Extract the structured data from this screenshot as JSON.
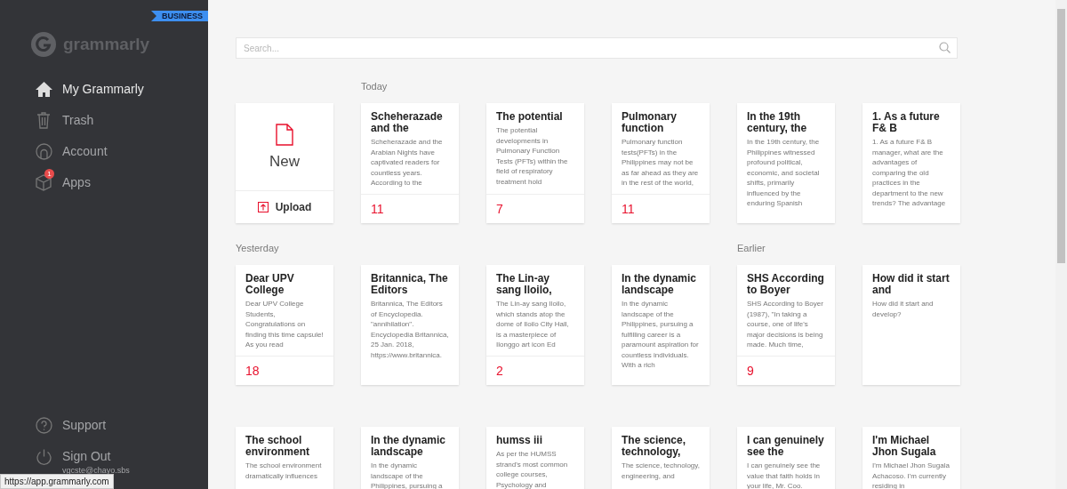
{
  "sidebar": {
    "plan": "BUSINESS",
    "logo": "grammarly",
    "nav": [
      {
        "label": "My Grammarly",
        "selected": true
      },
      {
        "label": "Trash",
        "selected": false
      },
      {
        "label": "Account",
        "selected": false
      },
      {
        "label": "Apps",
        "selected": false,
        "badge": "1"
      }
    ],
    "footer": [
      {
        "label": "Support"
      },
      {
        "label": "Sign Out"
      }
    ],
    "email": "vgcste@chayo.sbs"
  },
  "search": {
    "placeholder": "Search..."
  },
  "rows": [
    {
      "cards": [
        {
          "kind": "new",
          "label": "New",
          "action": "Upload"
        },
        {
          "kind": "doc",
          "section": "Today",
          "title": "Scheherazade and the",
          "excerpt": "Scheherazade and the Arabian Nights have captivated readers for countless years. According to the",
          "count": "11"
        },
        {
          "kind": "doc",
          "title": "The potential",
          "excerpt": "The potential developments in Pulmonary Function Tests (PFTs) within the field of respiratory treatment hold",
          "count": "7"
        },
        {
          "kind": "doc",
          "title": "Pulmonary function",
          "excerpt": "Pulmonary function tests(PFTs) in the Philippines may not be as far ahead as they are in the rest of the world,",
          "count": "11"
        },
        {
          "kind": "doc",
          "title": "In the 19th century, the",
          "excerpt": "In the 19th century, the Philippines witnessed profound political, economic, and societal shifts, primarily influenced by the enduring Spanish"
        },
        {
          "kind": "doc",
          "title": "1. As a future F& B",
          "excerpt": "1. As a future F& B manager, what are the advantages of comparing the old practices in the department to the new trends? The advantage"
        }
      ]
    },
    {
      "cards": [
        {
          "kind": "doc",
          "section": "Yesterday",
          "title": "Dear UPV College",
          "excerpt": "Dear UPV College Students, Congratulations on finding this time capsule! As you read",
          "count": "18"
        },
        {
          "kind": "doc",
          "title": "Britannica, The Editors",
          "excerpt": "Britannica, The Editors of Encyclopedia. \"annihilation\". Encyclopedia Britannica, 25 Jan. 2018, https://www.britannica."
        },
        {
          "kind": "doc",
          "title": "The Lin-ay sang Iloilo,",
          "excerpt": "The Lin-ay sang Iloilo, which stands atop the dome of Iloilo City Hall, is a masterpiece of Ilonggo art icon Ed",
          "count": "2"
        },
        {
          "kind": "doc",
          "title": "In the dynamic landscape",
          "excerpt": "In the dynamic landscape of the Philippines, pursuing a fulfilling career is a paramount aspiration for countless individuals. With a rich"
        },
        {
          "kind": "doc",
          "section": "Earlier",
          "title": "SHS According to Boyer",
          "excerpt": "SHS According to Boyer (1987), \"In taking a course, one of life's major decisions is being made. Much time,",
          "count": "9"
        },
        {
          "kind": "doc",
          "title": "How did it start and",
          "excerpt": "How did it start and develop?"
        }
      ]
    },
    {
      "cards": [
        {
          "kind": "doc",
          "title": "The school environment",
          "excerpt": "The school environment dramatically influences"
        },
        {
          "kind": "doc",
          "title": "In the dynamic landscape",
          "excerpt": "In the dynamic landscape of the Philippines, pursuing a"
        },
        {
          "kind": "doc",
          "title": "humss iii",
          "excerpt": "As per the HUMSS strand's most common college courses, Psychology and"
        },
        {
          "kind": "doc",
          "title": "The science, technology,",
          "excerpt": "The science, technology, engineering, and"
        },
        {
          "kind": "doc",
          "title": "I can genuinely see the",
          "excerpt": "I can genuinely see the value that faith holds in your life, Mr. Coo."
        },
        {
          "kind": "doc",
          "title": "I'm Michael Jhon Sugala",
          "excerpt": "I'm Michael Jhon Sugala Achacoso. I'm currently residing in"
        }
      ]
    }
  ],
  "status_url": "https://app.grammarly.com"
}
